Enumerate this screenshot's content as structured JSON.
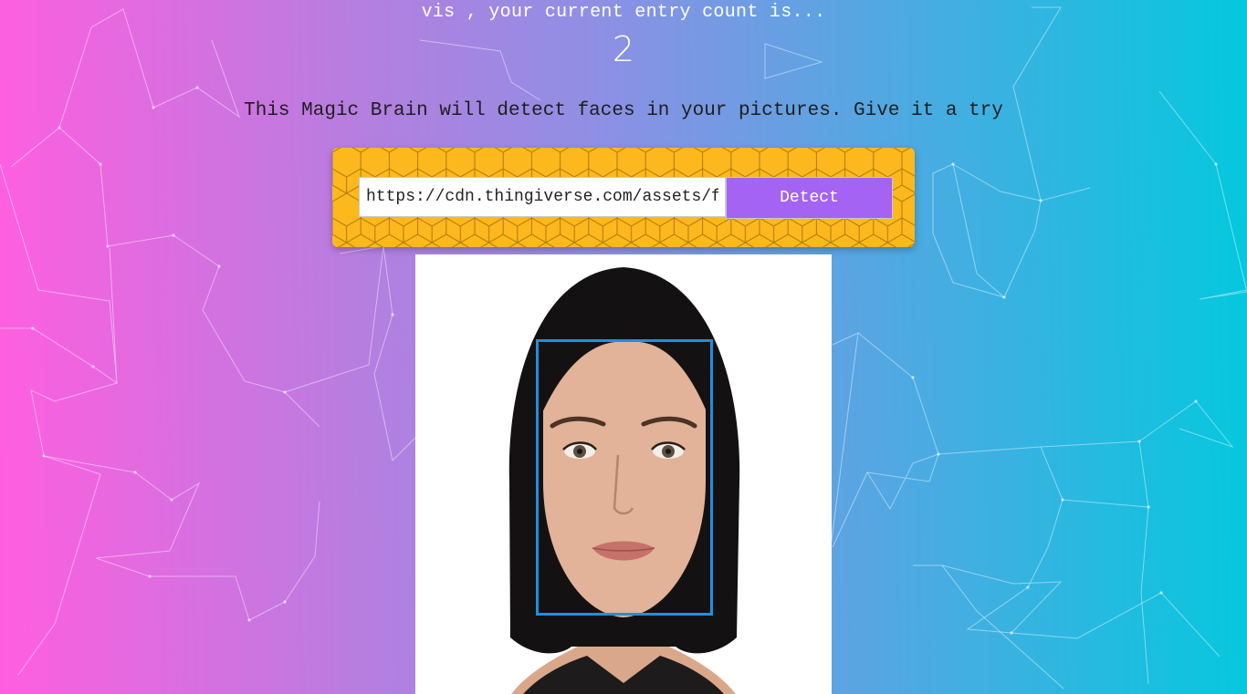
{
  "header": {
    "entry_text": "vis , your current entry count is...",
    "entry_count": "2"
  },
  "tagline": "This Magic Brain will detect faces in your pictures. Give it a try",
  "form": {
    "url_value": "https://cdn.thingiverse.com/assets/f",
    "detect_label": "Detect"
  },
  "result": {
    "faces_detected": 1
  },
  "colors": {
    "gradient_left": "#ff5edf",
    "gradient_right": "#04c8de",
    "panel": "#fdb81e",
    "button": "#a463f2",
    "face_box": "#1f8fe0"
  }
}
